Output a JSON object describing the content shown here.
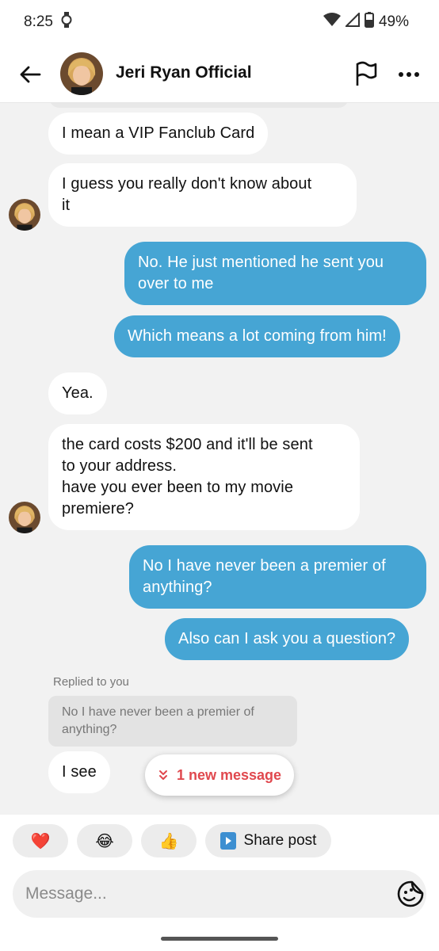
{
  "status_bar": {
    "time": "8:25",
    "battery": "49%"
  },
  "header": {
    "title": "Jeri Ryan Official"
  },
  "messages": {
    "m1": {
      "lines": [
        "I mean a VIP Fanclub Card"
      ]
    },
    "m2": {
      "lines": [
        "I guess you really don't know about",
        "it"
      ]
    },
    "m3": {
      "lines": [
        "No. He just mentioned he sent you",
        "over to me"
      ]
    },
    "m4": {
      "lines": [
        "Which means a lot coming from him!"
      ]
    },
    "m5": {
      "lines": [
        "Yea."
      ]
    },
    "m6": {
      "lines": [
        "the card costs $200 and it'll be sent",
        "to your address.",
        "have you ever been to my movie",
        "premiere?"
      ]
    },
    "m7": {
      "lines": [
        "No I have never been a premier of",
        "anything?"
      ]
    },
    "m8": {
      "lines": [
        "Also can I ask you a question?"
      ]
    },
    "m9": {
      "lines": [
        "I see"
      ]
    }
  },
  "reply": {
    "label": "Replied to you",
    "quote_lines": [
      "No I have never been a premier of",
      "anything?"
    ]
  },
  "new_message_pill": {
    "label": "1 new message"
  },
  "reactions": {
    "heart": "❤️",
    "laugh": "😂",
    "thumbs": "👍",
    "share_label": "Share post"
  },
  "composer": {
    "placeholder": "Message..."
  },
  "colors": {
    "outgoing_bubble": "#46a5d4",
    "incoming_bubble": "#ffffff",
    "accent_red": "#e0484e"
  }
}
